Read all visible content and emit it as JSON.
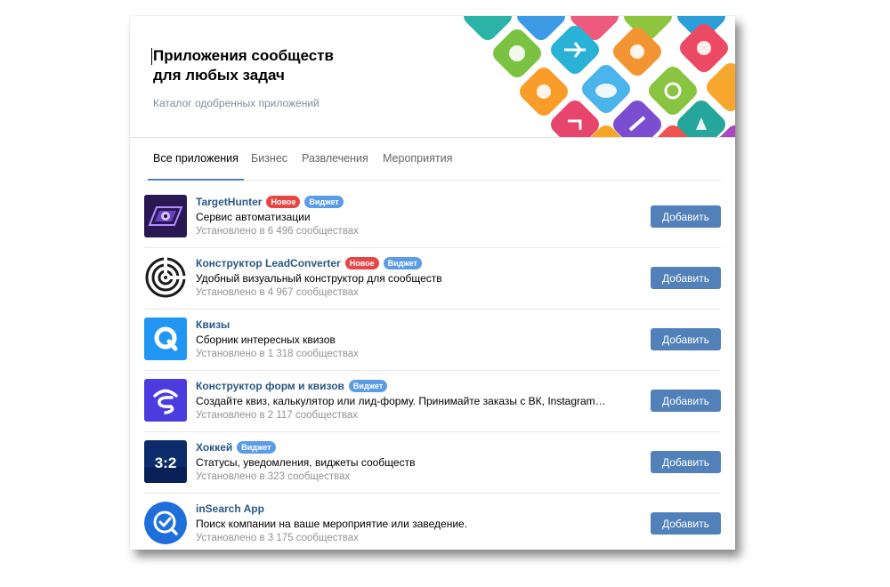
{
  "header": {
    "title": "Приложения сообществ\nдля любых задач",
    "subtitle": "Каталог одобренных приложений"
  },
  "tabs": [
    {
      "label": "Все приложения",
      "active": true
    },
    {
      "label": "Бизнес",
      "active": false
    },
    {
      "label": "Развлечения",
      "active": false
    },
    {
      "label": "Мероприятия",
      "active": false
    }
  ],
  "badges": {
    "new": "Новое",
    "widget": "Виджет"
  },
  "add_label": "Добавить",
  "apps": [
    {
      "name": "TargetHunter",
      "is_new": true,
      "is_widget": true,
      "desc": "Сервис автоматизации",
      "installs": "Установлено в 6 496 сообществах",
      "icon": "targethunter-logo"
    },
    {
      "name": "Конструктор LeadConverter",
      "is_new": true,
      "is_widget": true,
      "desc": "Удобный визуальный конструктор для сообществ",
      "installs": "Установлено в 4 967 сообществах",
      "icon": "leadconverter-target-logo"
    },
    {
      "name": "Квизы",
      "is_new": false,
      "is_widget": false,
      "desc": "Сборник интересных квизов",
      "installs": "Установлено в 1 318 сообществах",
      "icon": "quiz-q-logo"
    },
    {
      "name": "Конструктор форм и квизов",
      "is_new": false,
      "is_widget": true,
      "desc": "Создайте квиз, калькулятор или лид-форму. Принимайте заказы с ВК, Instagram и любых сайтов",
      "installs": "Установлено в 2 117 сообществах",
      "icon": "forms-s-logo"
    },
    {
      "name": "Хоккей",
      "is_new": false,
      "is_widget": true,
      "desc": "Статусы, уведомления, виджеты сообществ",
      "installs": "Установлено в 323 сообществах",
      "icon": "hockey-score-logo",
      "icon_text": "3:2"
    },
    {
      "name": "inSearch App",
      "is_new": false,
      "is_widget": false,
      "desc": "Поиск компании на ваше мероприятие или заведение.",
      "installs": "Установлено в 3 175 сообществах",
      "icon": "insearch-check-logo"
    }
  ],
  "colors": {
    "accent": "#5181b8",
    "link": "#2a5885",
    "badge_new": "#e64646",
    "badge_widget": "#5c9ce6"
  }
}
